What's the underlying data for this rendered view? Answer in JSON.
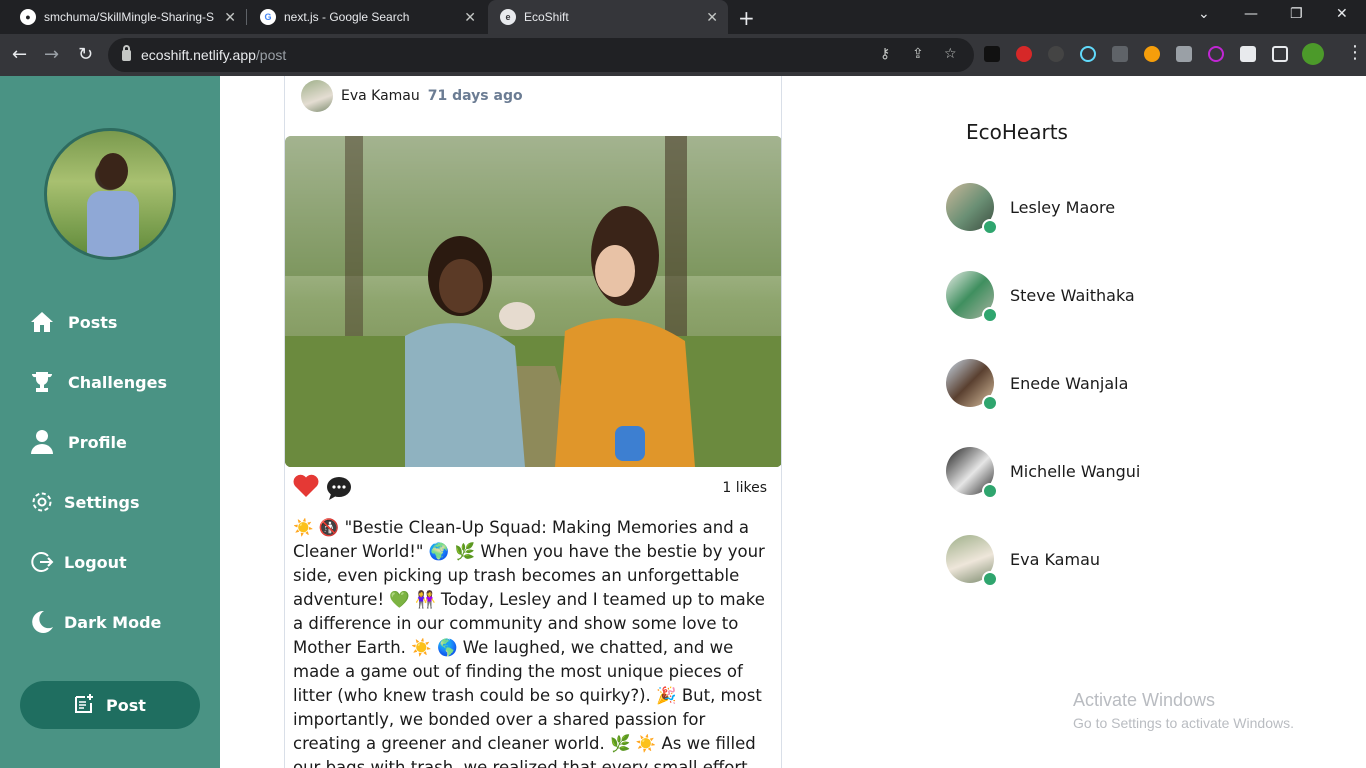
{
  "browser": {
    "tabs": [
      {
        "title": "smchuma/SkillMingle-Sharing-S",
        "icon": "github-icon"
      },
      {
        "title": "next.js - Google Search",
        "icon": "google-icon"
      },
      {
        "title": "EcoShift",
        "icon": "ecoshift-icon"
      }
    ],
    "new_tab": "+",
    "url_host": "ecoshift.netlify.app",
    "url_path": "/post"
  },
  "sidebar": {
    "items": [
      {
        "label": "Posts",
        "icon": "home-icon"
      },
      {
        "label": "Challenges",
        "icon": "trophy-icon"
      },
      {
        "label": "Profile",
        "icon": "user-icon"
      },
      {
        "label": "Settings",
        "icon": "gear-icon"
      },
      {
        "label": "Logout",
        "icon": "logout-icon"
      },
      {
        "label": "Dark Mode",
        "icon": "moon-icon"
      }
    ],
    "post_button": "Post"
  },
  "post": {
    "author": "Eva Kamau",
    "time": "71 days ago",
    "likes": "1 likes",
    "text": "☀️ 🚯 \"Bestie Clean-Up Squad: Making Memories and a Cleaner World!\" 🌍 🌿 When you have the bestie by your side, even picking up trash becomes an unforgettable adventure! 💚 👭 Today, Lesley and I teamed up to make a difference in our community and show some love to Mother Earth. ☀️ 🌎 We laughed, we chatted, and we made a game out of finding the most unique pieces of litter (who knew trash could be so quirky?). 🎉 But, most importantly, we bonded over a shared passion for creating a greener and cleaner world. 🌿 ☀️ As we filled our bags with trash, we realized that every small effort counts. By picking up after"
  },
  "ecohearts": {
    "title": "EcoHearts",
    "people": [
      {
        "name": "Lesley Maore"
      },
      {
        "name": "Steve Waithaka"
      },
      {
        "name": "Enede Wanjala"
      },
      {
        "name": "Michelle Wangui"
      },
      {
        "name": "Eva Kamau"
      }
    ]
  },
  "watermark": {
    "line1": "Activate Windows",
    "line2": "Go to Settings to activate Windows."
  }
}
